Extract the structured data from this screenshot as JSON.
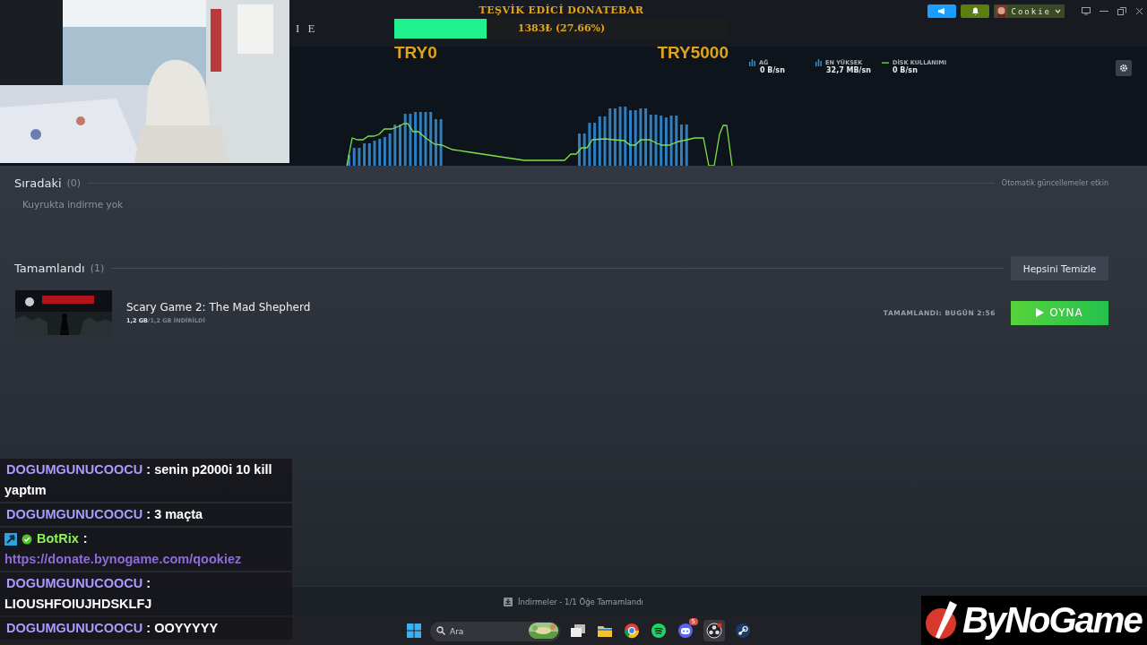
{
  "donatebar": {
    "title": "TEŞVİK EDİCİ DONATEBAR",
    "level": 0.2766,
    "reading": "1383₺ (27.66%)",
    "min": "TRY0",
    "max": "TRY5000"
  },
  "menu_fragment": "I E",
  "user": {
    "name": "Cookie"
  },
  "stats": [
    {
      "kind": "bars",
      "label": "AĞ",
      "value": "0 B/sn"
    },
    {
      "kind": "bars",
      "label": "EN YÜKSEK",
      "value": "32,7 MB/sn"
    },
    {
      "kind": "line",
      "label": "DİSK KULLANIMI",
      "value": "0 B/sn"
    }
  ],
  "queue": {
    "title": "Sıradaki",
    "count": "(0)",
    "empty_text": "Kuyrukta indirme yok",
    "auto_updates": "Otomatik güncellemeler etkin"
  },
  "completed": {
    "title": "Tamamlandı",
    "count": "(1)",
    "clear_button": "Hepsini Temizle",
    "items": [
      {
        "name": "Scary Game 2: The Mad Shepherd",
        "downloaded": "1,2 GB",
        "total": "/1,2 GB İNDİRİLDİ",
        "status": "TAMAMLANDI: BUGÜN 2:56",
        "action": "OYNA"
      }
    ]
  },
  "status_bar": "İndirmeler - 1/1 Öğe Tamamlandı",
  "taskbar": {
    "search_placeholder": "Ara",
    "notification_badge": "5"
  },
  "chat": [
    {
      "kind": "user",
      "user": "DOGUMGUNUCOOCU",
      "color": "#a99cff",
      "separator": ":",
      "text": "senin p2000i 10 kill yaptım"
    },
    {
      "kind": "user",
      "user": "DOGUMGUNUCOOCU",
      "color": "#a99cff",
      "separator": ":",
      "text": "3 maçta"
    },
    {
      "kind": "bot",
      "user": "BotRix",
      "color": "#8ef25a",
      "separator": ":",
      "text": "https://donate.bynogame.com/qookiez"
    },
    {
      "kind": "user",
      "user": "DOGUMGUNUCOOCU",
      "color": "#a99cff",
      "separator": ":",
      "text": "LIOUSHFOIUJHDSKLFJ"
    },
    {
      "kind": "user",
      "user": "DOGUMGUNUCOOCU",
      "color": "#a99cff",
      "separator": ":",
      "text": "OOYYYYY"
    }
  ],
  "logo": "ByNoGame"
}
